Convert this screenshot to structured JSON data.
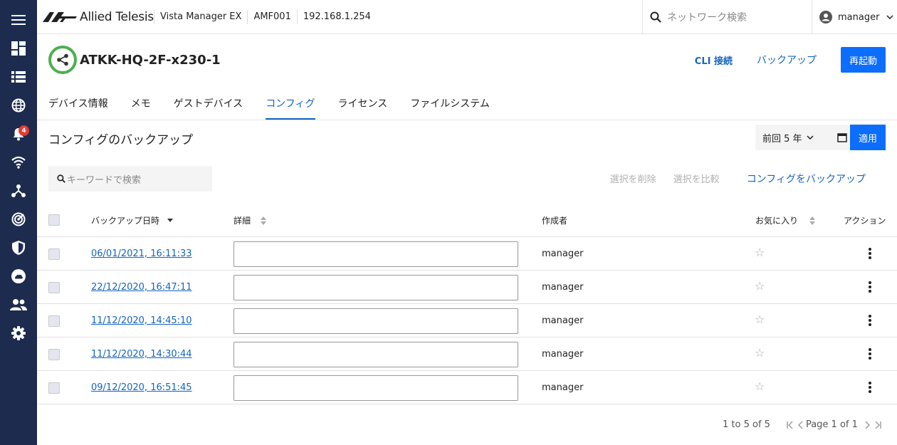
{
  "sidebar": {
    "items": [
      {
        "icon": "menu-icon"
      },
      {
        "icon": "dashboard-icon"
      },
      {
        "icon": "list-icon"
      },
      {
        "icon": "globe-icon"
      },
      {
        "icon": "bell-icon",
        "badge": "4"
      },
      {
        "icon": "wifi-icon"
      },
      {
        "icon": "topology-icon"
      },
      {
        "icon": "radar-icon"
      },
      {
        "icon": "shield-icon"
      },
      {
        "icon": "cloud-icon"
      },
      {
        "icon": "users-icon"
      },
      {
        "icon": "settings-icon"
      }
    ]
  },
  "header": {
    "brand": "Allied Telesis",
    "breadcrumbs": [
      "Vista Manager EX",
      "AMF001",
      "192.168.1.254"
    ],
    "search_placeholder": "ネットワーク検索",
    "user": "manager"
  },
  "device": {
    "name": "ATKK-HQ-2F-x230-1",
    "status_color": "#4caf50",
    "actions": {
      "cli": "CLI 接続",
      "backup": "バックアップ",
      "reboot": "再起動"
    }
  },
  "tabs": [
    {
      "label": "デバイス情報",
      "active": false
    },
    {
      "label": "メモ",
      "active": false
    },
    {
      "label": "ゲストデバイス",
      "active": false
    },
    {
      "label": "コンフィグ",
      "active": true
    },
    {
      "label": "ライセンス",
      "active": false
    },
    {
      "label": "ファイルシステム",
      "active": false
    }
  ],
  "section": {
    "title": "コンフィグのバックアップ",
    "period_label": "前回 5 年",
    "apply_label": "適用",
    "search_placeholder": "キーワードで検索",
    "delete_label": "選択を削除",
    "compare_label": "選択を比較",
    "backup_config_label": "コンフィグをバックアップ"
  },
  "table": {
    "columns": {
      "date": "バックアップ日時",
      "detail": "詳細",
      "creator": "作成者",
      "favorite": "お気に入り",
      "action": "アクション"
    },
    "rows": [
      {
        "date": "06/01/2021, 16:11:33",
        "detail": "",
        "creator": "manager"
      },
      {
        "date": "22/12/2020, 16:47:11",
        "detail": "",
        "creator": "manager"
      },
      {
        "date": "11/12/2020, 14:45:10",
        "detail": "",
        "creator": "manager"
      },
      {
        "date": "11/12/2020, 14:30:44",
        "detail": "",
        "creator": "manager"
      },
      {
        "date": "09/12/2020, 16:51:45",
        "detail": "",
        "creator": "manager"
      }
    ]
  },
  "pagination": {
    "range": "1 to 5 of 5",
    "page_text": "Page 1 of 1"
  },
  "colors": {
    "sidebar_bg": "#1d2b4f",
    "accent": "#0d6efd",
    "link": "#1565c0"
  }
}
